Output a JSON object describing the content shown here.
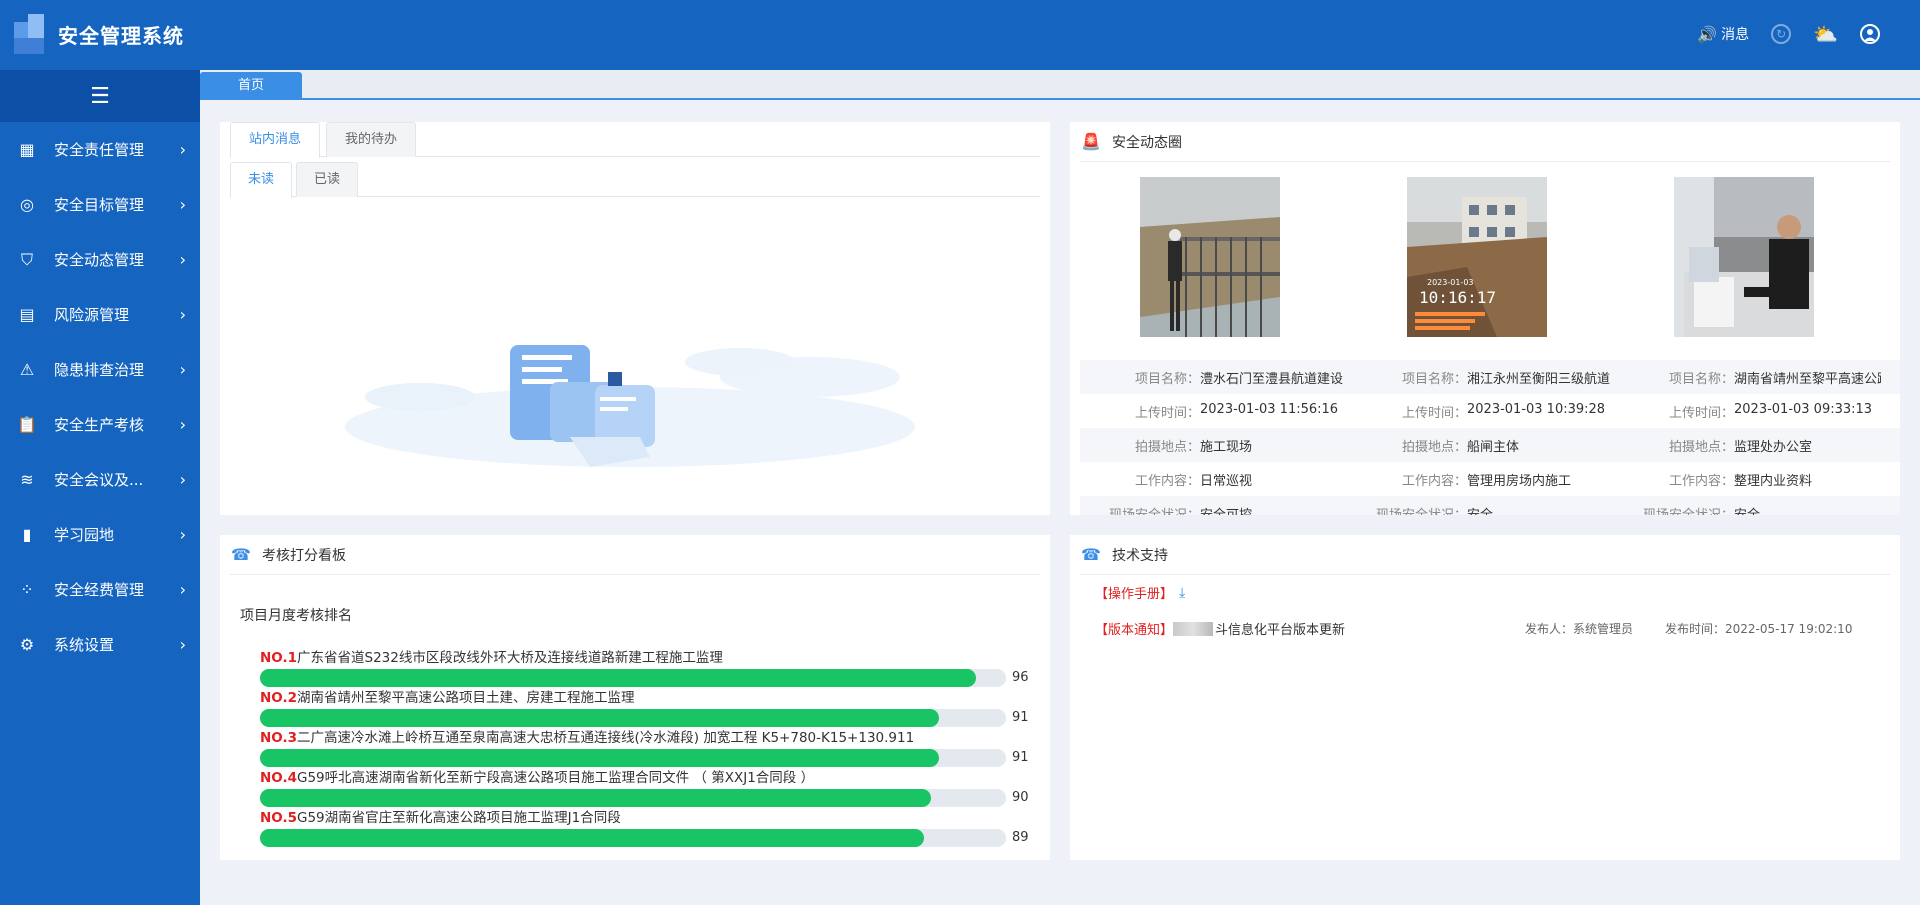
{
  "header": {
    "title": "安全管理系统",
    "message_label": "消息"
  },
  "sidebar": {
    "items": [
      {
        "label": "安全责任管理",
        "icon": "map-icon"
      },
      {
        "label": "安全目标管理",
        "icon": "target-icon"
      },
      {
        "label": "安全动态管理",
        "icon": "shield-icon"
      },
      {
        "label": "风险源管理",
        "icon": "document-gear-icon"
      },
      {
        "label": "隐患排查治理",
        "icon": "warning-icon"
      },
      {
        "label": "安全生产考核",
        "icon": "clipboard-icon"
      },
      {
        "label": "安全会议及...",
        "icon": "layers-icon"
      },
      {
        "label": "学习园地",
        "icon": "bar-chart-icon"
      },
      {
        "label": "安全经费管理",
        "icon": "grid-icon"
      },
      {
        "label": "系统设置",
        "icon": "gear-icon"
      }
    ]
  },
  "tabs": {
    "home": "首页"
  },
  "messages": {
    "tab_inbox": "站内消息",
    "tab_todo": "我的待办",
    "tab_unread": "未读",
    "tab_read": "已读"
  },
  "dynamics": {
    "title": "安全动态圈",
    "labels": {
      "project": "项目名称：",
      "upload_time": "上传时间：",
      "location": "拍摄地点：",
      "work": "工作内容：",
      "status": "现场安全状况："
    },
    "cards": [
      {
        "project": "澧水石门至澧县航道建设",
        "upload_time": "2023-01-03 11:56:16",
        "location": "施工现场",
        "work": "日常巡视",
        "status": "安全可控"
      },
      {
        "project": "湘江永州至衡阳三级航道",
        "upload_time": "2023-01-03 10:39:28",
        "location": "船闸主体",
        "work": "管理用房场内施工",
        "status": "安全"
      },
      {
        "project": "湖南省靖州至黎平高速公路",
        "upload_time": "2023-01-03 09:33:13",
        "location": "监理处办公室",
        "work": "整理内业资料",
        "status": "安全"
      }
    ],
    "photo2_timestamp_date": "2023-01-03",
    "photo2_timestamp_time": "10:16:17"
  },
  "assessment": {
    "title": "考核打分看板",
    "subtitle": "项目月度考核排名",
    "max_score": 100,
    "ranking": [
      {
        "no": "NO.1",
        "name": "广东省省道S232线市区段改线外环大桥及连接线道路新建工程施工监理",
        "score": 96
      },
      {
        "no": "NO.2",
        "name": "湖南省靖州至黎平高速公路项目土建、房建工程施工监理",
        "score": 91
      },
      {
        "no": "NO.3",
        "name": "二广高速冷水滩上岭桥互通至泉南高速大忠桥互通连接线(冷水滩段) 加宽工程 K5+780-K15+130.911",
        "score": 91
      },
      {
        "no": "NO.4",
        "name": "G59呼北高速湖南省新化至新宁段高速公路项目施工监理合同文件 （ 第XXJ1合同段 ）",
        "score": 90
      },
      {
        "no": "NO.5",
        "name": "G59湖南省官庄至新化高速公路项目施工监理J1合同段",
        "score": 89
      }
    ]
  },
  "support": {
    "title": "技术支持",
    "manual_label": "【操作手册】",
    "notice_tag": "【版本通知】",
    "notice_text": "斗信息化平台版本更新",
    "publisher": "发布人：系统管理员",
    "publish_time": "发布时间：2022-05-17 19:02:10"
  }
}
